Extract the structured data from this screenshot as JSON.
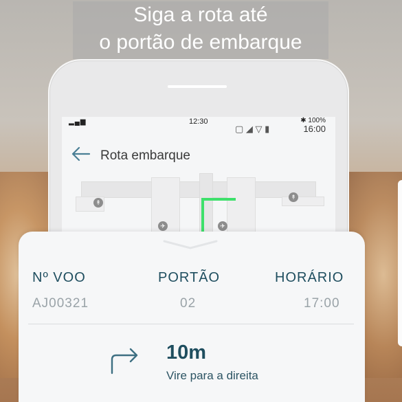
{
  "headline": {
    "line1": "Siga a rota até",
    "line2": "o portão de embarque"
  },
  "status_bar": {
    "signal": "▂▄▆",
    "time": "12:30",
    "bt_battery": "✱ 100%",
    "clock": "16:00"
  },
  "app_bar": {
    "title": "Rota embarque",
    "back_icon": "arrow-left-icon"
  },
  "flight_info": {
    "flight_label": "Nº VOO",
    "flight_value": "AJ00321",
    "gate_label": "PORTÃO",
    "gate_value": "02",
    "time_label": "HORÁRIO",
    "time_value": "17:00"
  },
  "navigation": {
    "distance": "10m",
    "instruction": "Vire para a direita",
    "turn_icon": "turn-right-arrow-icon"
  },
  "colors": {
    "primary_text": "#1f4e5f",
    "muted_text": "#9aa3a8",
    "route": "#3ee06b",
    "back_arrow": "#4a7f95"
  }
}
